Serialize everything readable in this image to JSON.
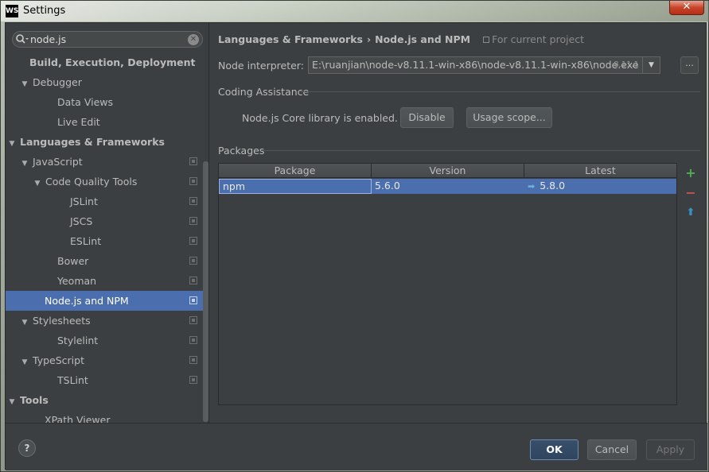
{
  "window": {
    "app_icon": "WS",
    "title": "Settings",
    "close_glyph": "✕"
  },
  "search": {
    "value": "node.js",
    "icon": "search-icon",
    "clear_icon": "clear-icon"
  },
  "tree": [
    {
      "label": "Build, Execution, Deployment",
      "bold": true,
      "arrow": "",
      "icon": false
    },
    {
      "label": "Debugger",
      "bold": false,
      "arrow": "▼",
      "icon": false
    },
    {
      "label": "Data Views",
      "bold": false,
      "arrow": "",
      "icon": false
    },
    {
      "label": "Live Edit",
      "bold": false,
      "arrow": "",
      "icon": false
    },
    {
      "label": "Languages & Frameworks",
      "bold": true,
      "arrow": "▼",
      "icon": false
    },
    {
      "label": "JavaScript",
      "bold": false,
      "arrow": "▼",
      "icon": true
    },
    {
      "label": "Code Quality Tools",
      "bold": false,
      "arrow": "▼",
      "icon": true
    },
    {
      "label": "JSLint",
      "bold": false,
      "arrow": "",
      "icon": true
    },
    {
      "label": "JSCS",
      "bold": false,
      "arrow": "",
      "icon": true
    },
    {
      "label": "ESLint",
      "bold": false,
      "arrow": "",
      "icon": true
    },
    {
      "label": "Bower",
      "bold": false,
      "arrow": "",
      "icon": true
    },
    {
      "label": "Yeoman",
      "bold": false,
      "arrow": "",
      "icon": true
    },
    {
      "label": "Node.js and NPM",
      "bold": false,
      "arrow": "",
      "icon": true,
      "selected": true
    },
    {
      "label": "Stylesheets",
      "bold": false,
      "arrow": "▼",
      "icon": true
    },
    {
      "label": "Stylelint",
      "bold": false,
      "arrow": "",
      "icon": true
    },
    {
      "label": "TypeScript",
      "bold": false,
      "arrow": "▼",
      "icon": true
    },
    {
      "label": "TSLint",
      "bold": false,
      "arrow": "",
      "icon": true
    },
    {
      "label": "Tools",
      "bold": true,
      "arrow": "▼",
      "icon": false
    },
    {
      "label": "XPath Viewer",
      "bold": false,
      "arrow": "",
      "icon": false
    }
  ],
  "breadcrumb": {
    "parent": "Languages & Frameworks",
    "separator": "›",
    "current": "Node.js and NPM",
    "scope": "For current project"
  },
  "interpreter": {
    "label": "Node interpreter:",
    "value": "E:\\ruanjian\\node-v8.11.1-win-x86\\node-v8.11.1-win-x86\\node.exe",
    "version": "8.11.1",
    "more": "..."
  },
  "coding_assistance": {
    "label": "Coding Assistance",
    "status": "Node.js Core library is enabled.",
    "disable_label": "Disable",
    "usage_scope_label": "Usage scope..."
  },
  "packages": {
    "label": "Packages",
    "columns": [
      "Package",
      "Version",
      "Latest"
    ],
    "rows": [
      {
        "package": "npm",
        "version": "5.6.0",
        "latest": "5.8.0"
      }
    ],
    "add_glyph": "+",
    "remove_glyph": "−",
    "upgrade_glyph": "⬆"
  },
  "footer": {
    "help": "?",
    "ok": "OK",
    "cancel": "Cancel",
    "apply": "Apply"
  },
  "colors": {
    "background": "#3c3f41",
    "selection": "#4b6eaf",
    "add": "#4caf50",
    "remove": "#c75450",
    "upgrade": "#3592c4"
  }
}
